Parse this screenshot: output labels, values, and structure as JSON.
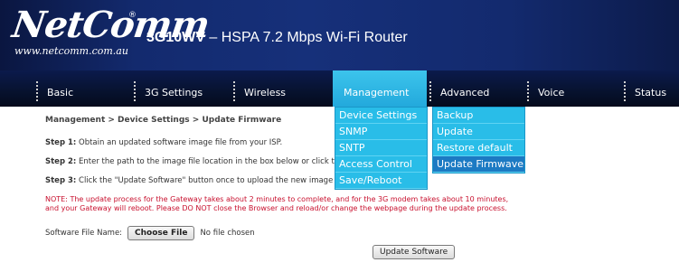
{
  "header": {
    "logo_text": "NetComm",
    "logo_reg": "®",
    "logo_url": "www.netcomm.com.au",
    "model": "3G10WV",
    "product_desc": " – HSPA 7.2 Mbps Wi-Fi Router"
  },
  "nav": {
    "items": [
      {
        "label": "Basic"
      },
      {
        "label": "3G Settings"
      },
      {
        "label": "Wireless"
      },
      {
        "label": "Management"
      },
      {
        "label": "Advanced"
      },
      {
        "label": "Voice"
      },
      {
        "label": "Status"
      }
    ],
    "active": "Management"
  },
  "dropdowns": {
    "management": [
      "Device Settings",
      "SNMP",
      "SNTP",
      "Access Control",
      "Save/Reboot"
    ],
    "device_settings": [
      "Backup",
      "Update",
      "Restore default",
      "Update Firmwave"
    ],
    "highlighted": "Update Firmwave"
  },
  "content": {
    "breadcrumb": "Management > Device Settings > Update Firmware",
    "step1_label": "Step 1:",
    "step1_text": " Obtain an updated software image file from your ISP.",
    "step2_label": "Step 2:",
    "step2_text": " Enter the path to the image file location in the box below or click the \"B",
    "step3_label": "Step 3:",
    "step3_text": " Click the \"Update Software\" button once to upload the new image file.",
    "note_line1": "NOTE: The update process for the Gateway takes about 2 minutes to complete, and for the 3G modem takes about 10 minutes,",
    "note_line2": "and your Gateway will reboot. Please DO NOT close the Browser and reload/or change the webpage during the update process.",
    "file_label": "Software File Name:",
    "choose_file": "Choose File",
    "no_file": "No file chosen",
    "update_button": "Update Software"
  },
  "colors": {
    "header_bg": "#16307a",
    "nav_bg": "#07122e",
    "menu_cyan": "#29bde8",
    "menu_highlight": "#1c7ac3",
    "note_red": "#c8102e"
  }
}
